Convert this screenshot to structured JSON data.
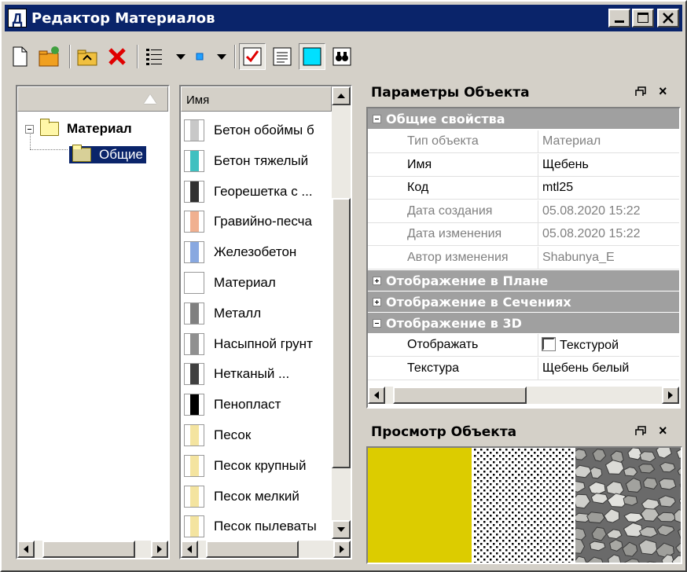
{
  "window": {
    "title": "Редактор Материалов",
    "app_icon_letter": "Д"
  },
  "toolbar": {
    "icons": [
      "new-icon",
      "new-folder-icon",
      "folder-up-icon",
      "delete-icon",
      "list-view-icon",
      "small-icon-view-icon",
      "checkbox-icon",
      "lines-icon",
      "preview-icon",
      "binoculars-icon"
    ]
  },
  "tree": {
    "root_label": "Материал",
    "child_label": "Общие"
  },
  "list": {
    "header": "Имя",
    "items": [
      {
        "label": "Бетон обоймы б",
        "swatch": "#c8c8c8"
      },
      {
        "label": "Бетон тяжелый",
        "swatch": "#40c0c0"
      },
      {
        "label": "Георешетка с ...",
        "swatch": "#303030"
      },
      {
        "label": "Гравийно-песча",
        "swatch": "#f0b090"
      },
      {
        "label": "Железобетон",
        "swatch": "#88a8e0"
      },
      {
        "label": "Материал",
        "swatch": "#ffffff"
      },
      {
        "label": "Металл",
        "swatch": "#808080"
      },
      {
        "label": "Насыпной грунт",
        "swatch": "#909090"
      },
      {
        "label": "Нетканый ...",
        "swatch": "#404040"
      },
      {
        "label": "Пенопласт",
        "swatch": "#000000"
      },
      {
        "label": "Песок",
        "swatch": "#f4e4a0"
      },
      {
        "label": "Песок крупный",
        "swatch": "#f4e4a0"
      },
      {
        "label": "Песок мелкий",
        "swatch": "#f4e4a0"
      },
      {
        "label": "Песок пылеваты",
        "swatch": "#f4e4a0"
      }
    ]
  },
  "properties": {
    "title": "Параметры Объекта",
    "groups": {
      "general": "Общие свойства",
      "plan": "Отображение в Плане",
      "sections": "Отображение в Сечениях",
      "view3d": "Отображение в 3D"
    },
    "rows": [
      {
        "name": "Тип объекта",
        "value": "Материал",
        "readonly": true
      },
      {
        "name": "Имя",
        "value": "Щебень",
        "readonly": false
      },
      {
        "name": "Код",
        "value": "mtl25",
        "readonly": false
      },
      {
        "name": "Дата создания",
        "value": "05.08.2020 15:22",
        "readonly": true
      },
      {
        "name": "Дата изменения",
        "value": "05.08.2020 15:22",
        "readonly": true
      },
      {
        "name": "Автор изменения",
        "value": "Shabunya_E",
        "readonly": true
      }
    ],
    "rows3d": [
      {
        "name": "Отображать",
        "value": "Текстурой"
      },
      {
        "name": "Текстура",
        "value": "Щебень белый"
      }
    ]
  },
  "preview": {
    "title": "Просмотр Объекта",
    "fill_color": "#dccc00"
  },
  "colors": {
    "title_bar": "#0a246a",
    "face": "#d4d0c8",
    "group_header": "#a0a0a0"
  }
}
